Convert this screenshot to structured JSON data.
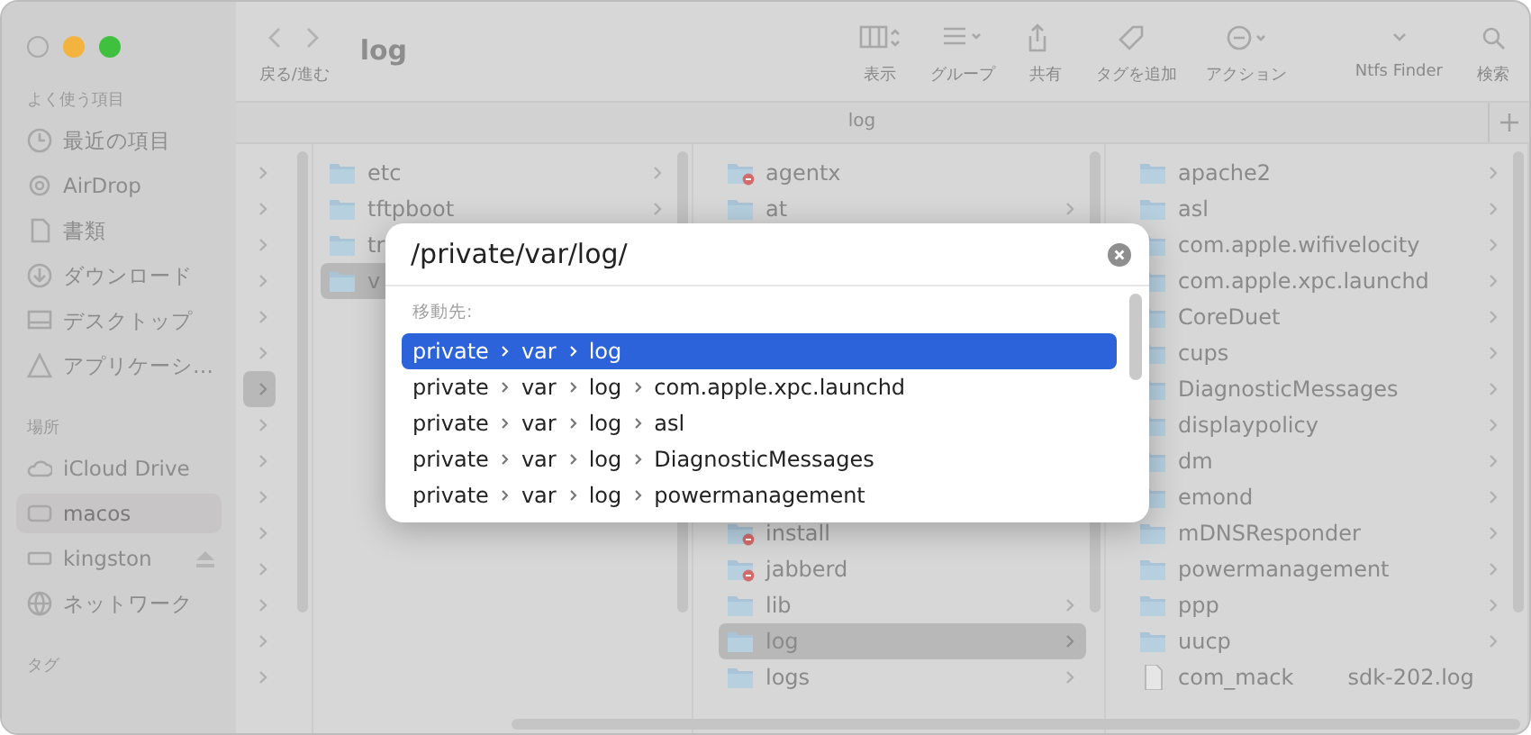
{
  "window": {
    "title": "log",
    "nav_label": "戻る/進む"
  },
  "toolbar": [
    {
      "kind": "view",
      "label": "表示"
    },
    {
      "kind": "group",
      "label": "グループ"
    },
    {
      "kind": "share",
      "label": "共有"
    },
    {
      "kind": "tag",
      "label": "タグを追加"
    },
    {
      "kind": "action",
      "label": "アクション"
    },
    {
      "kind": "extension",
      "label": "Ntfs Finder"
    },
    {
      "kind": "search",
      "label": "検索"
    }
  ],
  "tab_bar": {
    "tabs": [
      "log"
    ]
  },
  "sidebar": {
    "sections": [
      {
        "title": "よく使う項目",
        "items": [
          {
            "kind": "clock",
            "label": "最近の項目",
            "selected": false
          },
          {
            "kind": "airdrop",
            "label": "AirDrop",
            "selected": false
          },
          {
            "kind": "doc",
            "label": "書類",
            "selected": false
          },
          {
            "kind": "download",
            "label": "ダウンロード",
            "selected": false
          },
          {
            "kind": "desktop",
            "label": "デスクトップ",
            "selected": false
          },
          {
            "kind": "apps",
            "label": "アプリケーシ…",
            "selected": false
          }
        ]
      },
      {
        "title": "場所",
        "items": [
          {
            "kind": "cloud",
            "label": "iCloud Drive",
            "selected": false
          },
          {
            "kind": "disk",
            "label": "macos",
            "selected": true
          },
          {
            "kind": "drive",
            "label": "kingston",
            "selected": false,
            "eject": true
          },
          {
            "kind": "globe",
            "label": "ネットワーク",
            "selected": false
          }
        ]
      },
      {
        "title": "タグ"
      }
    ]
  },
  "columns": [
    {
      "items": [
        {
          "kind": "chevron",
          "selected": false
        },
        {
          "kind": "chevron",
          "selected": false
        },
        {
          "kind": "chevron",
          "selected": false
        },
        {
          "kind": "chevron",
          "selected": false
        },
        {
          "kind": "chevron",
          "selected": false
        },
        {
          "kind": "chevron",
          "selected": false
        },
        {
          "kind": "chevron",
          "selected": true
        },
        {
          "kind": "chevron",
          "selected": false
        },
        {
          "kind": "chevron",
          "selected": false
        },
        {
          "kind": "chevron",
          "selected": false
        },
        {
          "kind": "chevron",
          "selected": false
        },
        {
          "kind": "chevron",
          "selected": false
        },
        {
          "kind": "chevron",
          "selected": false
        },
        {
          "kind": "chevron",
          "selected": false
        },
        {
          "kind": "chevron",
          "selected": false
        }
      ]
    },
    {
      "items": [
        {
          "kind": "folder",
          "name": "etc",
          "selected": false
        },
        {
          "kind": "folder",
          "name": "tftpboot",
          "selected": false
        },
        {
          "kind": "folder_partial",
          "name": "tr",
          "selected": false
        },
        {
          "kind": "folder_partial",
          "name": "v",
          "selected": true
        }
      ]
    },
    {
      "items": [
        {
          "kind": "restricted",
          "name": "agentx",
          "selected": false
        },
        {
          "kind": "folder",
          "name": "at",
          "selected": false
        },
        {
          "kind": "hidden"
        },
        {
          "kind": "hidden"
        },
        {
          "kind": "hidden"
        },
        {
          "kind": "hidden"
        },
        {
          "kind": "hidden"
        },
        {
          "kind": "hidden"
        },
        {
          "kind": "hidden"
        },
        {
          "kind": "hidden"
        },
        {
          "kind": "restricted",
          "name": "install",
          "selected": false
        },
        {
          "kind": "restricted",
          "name": "jabberd",
          "selected": false
        },
        {
          "kind": "folder",
          "name": "lib",
          "selected": false
        },
        {
          "kind": "folder",
          "name": "log",
          "selected": true
        },
        {
          "kind": "folder",
          "name": "logs",
          "selected": false
        }
      ]
    },
    {
      "items": [
        {
          "kind": "folder",
          "name": "apache2",
          "selected": false
        },
        {
          "kind": "folder",
          "name": "asl",
          "selected": false
        },
        {
          "kind": "folder",
          "name": "com.apple.wifivelocity",
          "selected": false
        },
        {
          "kind": "folder",
          "name": "com.apple.xpc.launchd",
          "selected": false
        },
        {
          "kind": "folder",
          "name": "CoreDuet",
          "selected": false
        },
        {
          "kind": "folder",
          "name": "cups",
          "selected": false
        },
        {
          "kind": "folder",
          "name": "DiagnosticMessages",
          "selected": false
        },
        {
          "kind": "folder",
          "name": "displaypolicy",
          "selected": false
        },
        {
          "kind": "folder",
          "name": "dm",
          "selected": false
        },
        {
          "kind": "folder",
          "name": "emond",
          "selected": false
        },
        {
          "kind": "folder",
          "name": "mDNSResponder",
          "selected": false
        },
        {
          "kind": "folder",
          "name": "powermanagement",
          "selected": false
        },
        {
          "kind": "folder",
          "name": "ppp",
          "selected": false
        },
        {
          "kind": "folder",
          "name": "uucp",
          "selected": false
        },
        {
          "kind": "file",
          "name": "com_mack",
          "name_tail": "sdk-202.log",
          "selected": false
        }
      ]
    }
  ],
  "go_to_folder": {
    "value": "/private/var/log/",
    "header": "移動先:",
    "suggestions": [
      {
        "path": [
          "private",
          "var",
          "log"
        ],
        "selected": true
      },
      {
        "path": [
          "private",
          "var",
          "log",
          "com.apple.xpc.launchd"
        ],
        "selected": false
      },
      {
        "path": [
          "private",
          "var",
          "log",
          "asl"
        ],
        "selected": false
      },
      {
        "path": [
          "private",
          "var",
          "log",
          "DiagnosticMessages"
        ],
        "selected": false
      },
      {
        "path": [
          "private",
          "var",
          "log",
          "powermanagement"
        ],
        "selected": false
      }
    ]
  }
}
